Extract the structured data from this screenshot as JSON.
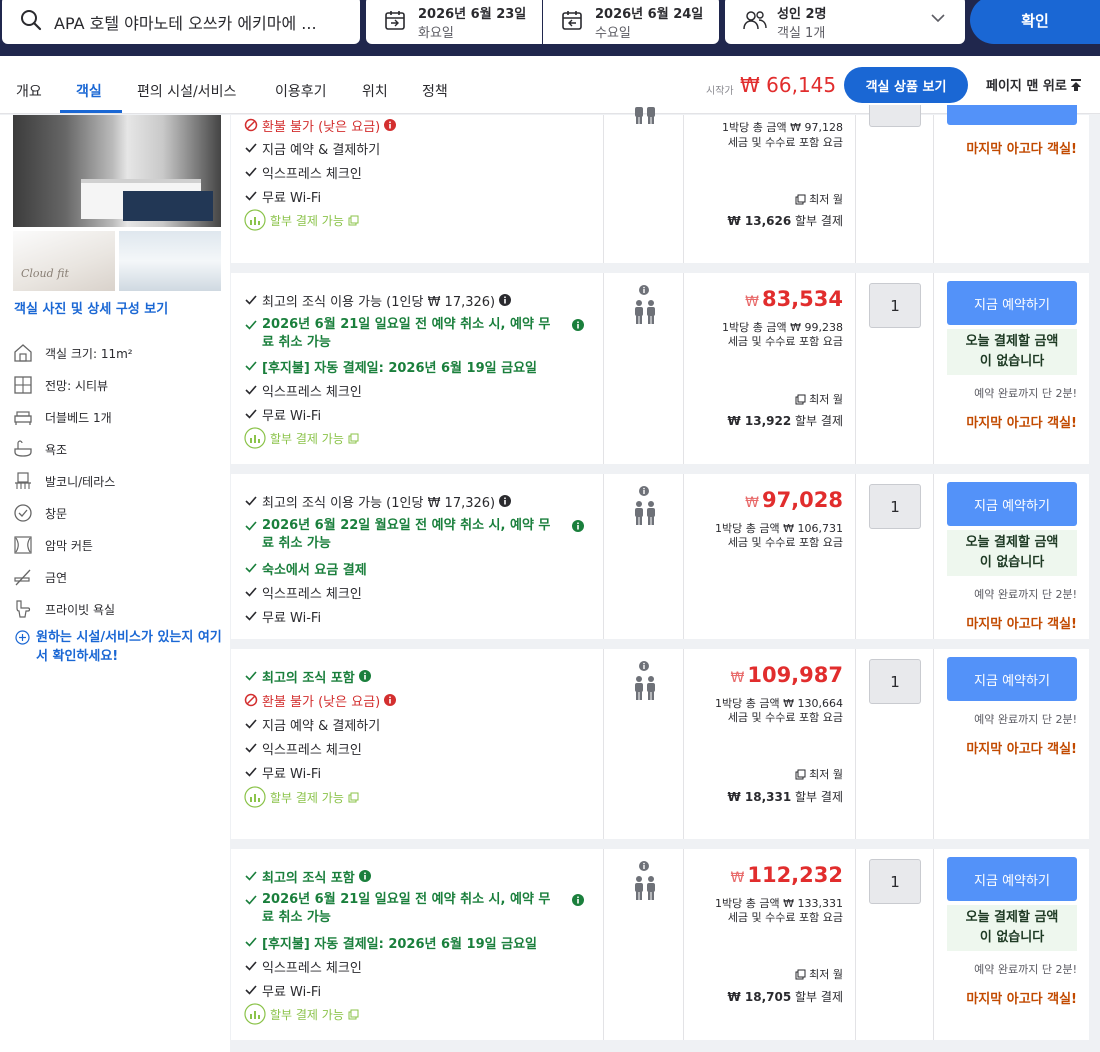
{
  "search": {
    "destination": "APA 호텔 야마노테 오쓰카 에키마에 ...",
    "checkin_date": "2026년 6월 23일",
    "checkin_day": "화요일",
    "checkout_date": "2026년 6월 24일",
    "checkout_day": "수요일",
    "guests": "성인 2명",
    "rooms": "객실 1개",
    "confirm": "확인"
  },
  "nav": {
    "tabs": [
      "개요",
      "객실",
      "편의 시설/서비스",
      "이용후기",
      "위치",
      "정책"
    ],
    "active_tab": "객실",
    "price_from_label": "시작가",
    "price_from": "₩ 66,145",
    "view_rooms": "객실 상품 보기",
    "back_to_top": "페이지 맨 위로"
  },
  "left": {
    "photo_logo": "Cloud fit",
    "gallery_link": "객실 사진 및 상세 구성 보기",
    "amenities": [
      {
        "icon": "room-size-icon",
        "label": "객실 크기: 11m²"
      },
      {
        "icon": "view-icon",
        "label": "전망: 시티뷰"
      },
      {
        "icon": "bed-icon",
        "label": "더블베드 1개"
      },
      {
        "icon": "bathtub-icon",
        "label": "욕조"
      },
      {
        "icon": "balcony-icon",
        "label": "발코니/테라스"
      },
      {
        "icon": "window-icon",
        "label": "창문"
      },
      {
        "icon": "curtain-icon",
        "label": "암막 커튼"
      },
      {
        "icon": "no-smoking-icon",
        "label": "금연"
      },
      {
        "icon": "private-bathroom-icon",
        "label": "프라이빗 욕실"
      }
    ],
    "more_amenities": "원하는 시설/서비스가 있는지 여기서 확인하세요!"
  },
  "rows": [
    {
      "features": [
        "환불 불가 (낮은 요금)",
        "지금 예약 & 결제하기",
        "익스프레스 체크인",
        "무료 Wi-Fi"
      ],
      "installment": "할부 결제 가능",
      "total": "1박당 총 금액 ₩ 97,128",
      "tax": "세금 및 수수료 포함 요금",
      "lowest": "최저 월",
      "monthly_amount": "₩ 13,626",
      "monthly_suffix": "할부 결제",
      "last_room": "마지막 아고다 객실!"
    },
    {
      "features": [
        "최고의 조식 이용 가능 (1인당 ₩ 17,326)",
        "2026년 6월 21일 일요일 전 예약 취소 시, 예약 무료 취소 가능",
        "[후지불] 자동 결제일: 2026년 6월 19일 금요일",
        "익스프레스 체크인",
        "무료 Wi-Fi"
      ],
      "installment": "할부 결제 가능",
      "price": "83,534",
      "total": "1박당 총 금액 ₩ 99,238",
      "tax": "세금 및 수수료 포함 요금",
      "lowest": "최저 월",
      "monthly_amount": "₩ 13,922",
      "monthly_suffix": "할부 결제",
      "qty": "1",
      "book": "지금 예약하기",
      "pay_none": "오늘 결제할 금액\n이 없습니다",
      "booking_time": "예약 완료까지 단 2분!",
      "last_room": "마지막 아고다 객실!"
    },
    {
      "features": [
        "최고의 조식 이용 가능 (1인당 ₩ 17,326)",
        "2026년 6월 22일 월요일 전 예약 취소 시, 예약 무료 취소 가능",
        "숙소에서 요금 결제",
        "익스프레스 체크인",
        "무료 Wi-Fi"
      ],
      "price": "97,028",
      "total": "1박당 총 금액 ₩ 106,731",
      "tax": "세금 및 수수료 포함 요금",
      "qty": "1",
      "book": "지금 예약하기",
      "pay_none": "오늘 결제할 금액\n이 없습니다",
      "booking_time": "예약 완료까지 단 2분!",
      "last_room": "마지막 아고다 객실!"
    },
    {
      "features": [
        "최고의 조식 포함",
        "환불 불가 (낮은 요금)",
        "지금 예약 & 결제하기",
        "익스프레스 체크인",
        "무료 Wi-Fi"
      ],
      "installment": "할부 결제 가능",
      "price": "109,987",
      "total": "1박당 총 금액 ₩ 130,664",
      "tax": "세금 및 수수료 포함 요금",
      "lowest": "최저 월",
      "monthly_amount": "₩ 18,331",
      "monthly_suffix": "할부 결제",
      "qty": "1",
      "book": "지금 예약하기",
      "booking_time": "예약 완료까지 단 2분!",
      "last_room": "마지막 아고다 객실!"
    },
    {
      "features": [
        "최고의 조식 포함",
        "2026년 6월 21일 일요일 전 예약 취소 시, 예약 무료 취소 가능",
        "[후지불] 자동 결제일: 2026년 6월 19일 금요일",
        "익스프레스 체크인",
        "무료 Wi-Fi"
      ],
      "installment": "할부 결제 가능",
      "price": "112,232",
      "total": "1박당 총 금액 ₩ 133,331",
      "tax": "세금 및 수수료 포함 요금",
      "lowest": "최저 월",
      "monthly_amount": "₩ 18,705",
      "monthly_suffix": "할부 결제",
      "qty": "1",
      "book": "지금 예약하기",
      "pay_none": "오늘 결제할 금액\n이 없습니다",
      "booking_time": "예약 완료까지 단 2분!",
      "last_room": "마지막 아고다 객실!"
    }
  ],
  "price_currency_symbol": "₩",
  "colors": {
    "brand_blue": "#1a67d4",
    "button_blue": "#5392f9",
    "price_red": "#e12d2d",
    "green": "#1a7f3c",
    "last_room_orange": "#c24a00",
    "header_navy": "#20274d"
  }
}
